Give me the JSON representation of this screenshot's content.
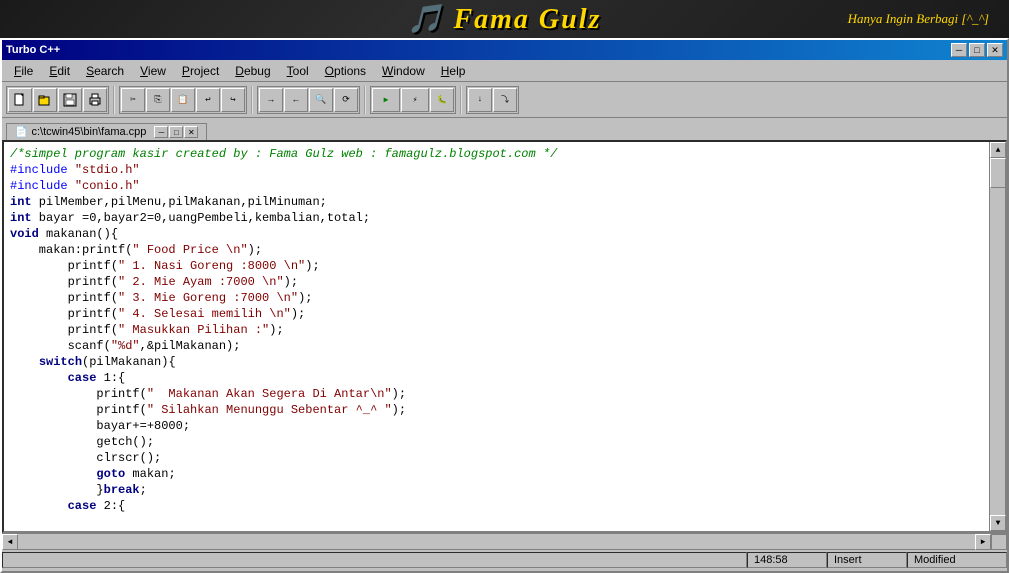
{
  "banner": {
    "title": "Fama Gulz",
    "subtitle": "Hanya Ingin Berbagi",
    "emoticon": "[^_^]"
  },
  "window": {
    "title": "Turbo C++"
  },
  "titlebar": {
    "title": "Turbo C++",
    "btn_minimize": "─",
    "btn_restore": "□",
    "btn_close": "✕"
  },
  "menubar": {
    "items": [
      "File",
      "Edit",
      "Search",
      "View",
      "Project",
      "Debug",
      "Tool",
      "Options",
      "Window",
      "Help"
    ]
  },
  "document": {
    "tab_title": "c:\\tcwin45\\bin\\fama.cpp"
  },
  "code": {
    "lines": [
      {
        "type": "comment",
        "text": "/*simpel program kasir created by : Fama Gulz web : famagulz.blogspot.com */"
      },
      {
        "type": "preprocessor",
        "text": "#include \"stdio.h\""
      },
      {
        "type": "preprocessor",
        "text": "#include \"conio.h\""
      },
      {
        "type": "normal",
        "text": "int pilMember,pilMenu,pilMakanan,pilMinuman;"
      },
      {
        "type": "normal",
        "text": "int bayar =0,bayar2=0,uangPembeli,kembalian,total;"
      },
      {
        "type": "keyword",
        "text": "void makanan(){"
      },
      {
        "type": "normal",
        "text": "    makan:printf(\" Food Price \\n\");"
      },
      {
        "type": "normal",
        "text": "        printf(\" 1. Nasi Goreng :8000 \\n\");"
      },
      {
        "type": "normal",
        "text": "        printf(\" 2. Mie Ayam :7000 \\n\");"
      },
      {
        "type": "normal",
        "text": "        printf(\" 3. Mie Goreng :7000 \\n\");"
      },
      {
        "type": "normal",
        "text": "        printf(\" 4. Selesai memilih \\n\");"
      },
      {
        "type": "normal",
        "text": "        printf(\" Masukkan Pilihan :\");"
      },
      {
        "type": "normal",
        "text": "        scanf(\"%d\",&pilMakanan);"
      },
      {
        "type": "keyword",
        "text": "    switch(pilMakanan){"
      },
      {
        "type": "normal",
        "text": "        case 1:{"
      },
      {
        "type": "normal",
        "text": "            printf(\"  Makanan Akan Segera Di Antar\\n\");"
      },
      {
        "type": "normal",
        "text": "            printf(\" Silahkan Menunggu Sebentar ^_^ \");"
      },
      {
        "type": "normal",
        "text": "            bayar+=+8000;"
      },
      {
        "type": "normal",
        "text": "            getch();"
      },
      {
        "type": "normal",
        "text": "            clrscr();"
      },
      {
        "type": "normal",
        "text": "            goto makan;"
      },
      {
        "type": "normal",
        "text": "            }break;"
      },
      {
        "type": "normal",
        "text": "        case 2:{"
      }
    ]
  },
  "statusbar": {
    "main": "",
    "position": "148:58",
    "insert": "Insert",
    "modified": "Modified"
  },
  "scrollbar": {
    "up": "▲",
    "down": "▼",
    "left": "◄",
    "right": "►"
  }
}
